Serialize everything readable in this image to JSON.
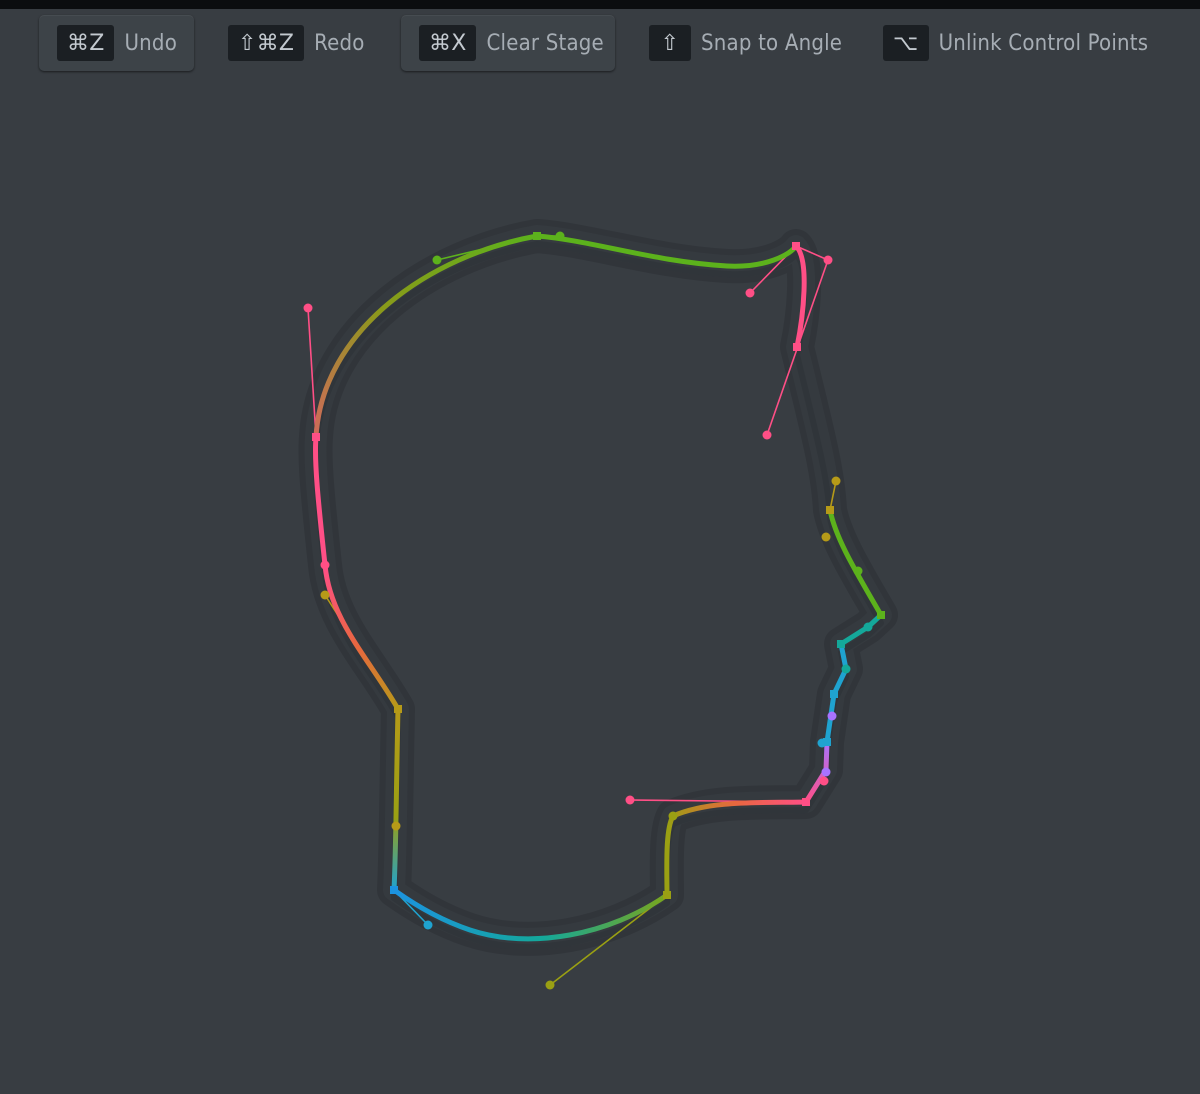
{
  "toolbar": {
    "undo": {
      "keys": "⌘Z",
      "label": "Undo"
    },
    "redo": {
      "keys": "⇧⌘Z",
      "label": "Redo"
    },
    "clear": {
      "keys": "⌘X",
      "label": "Clear Stage"
    },
    "snap": {
      "keys": "⇧",
      "label": "Snap to Angle"
    },
    "unlink": {
      "keys": "⌥",
      "label": "Unlink Control Points"
    }
  },
  "colors": {
    "background": "#383d42",
    "pink": "#ff4f86",
    "green": "#5cb21c",
    "olive": "#9aa013",
    "gold": "#b69a18",
    "teal": "#14a89a",
    "cyan": "#1fa3d0",
    "blue": "#1c93e0",
    "purple": "#a873ff"
  }
}
